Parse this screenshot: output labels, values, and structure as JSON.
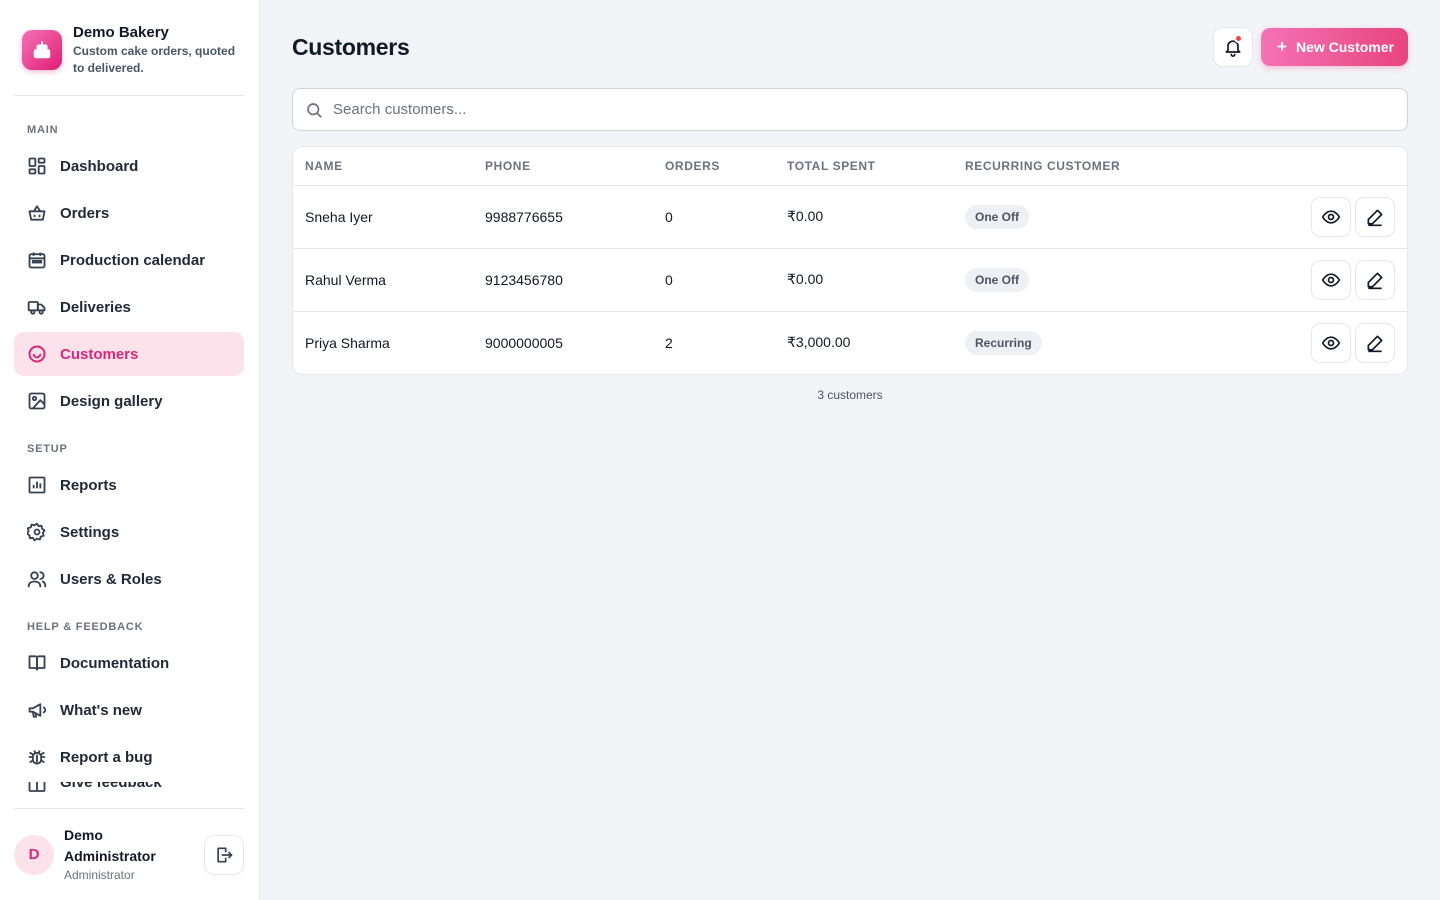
{
  "brand": {
    "name": "Demo Bakery",
    "tagline": "Custom cake orders, quoted to delivered."
  },
  "sidebar": {
    "sections": [
      {
        "label": "MAIN"
      },
      {
        "label": "SETUP"
      },
      {
        "label": "HELP & FEEDBACK"
      }
    ],
    "items": [
      {
        "label": "Dashboard",
        "icon": "dashboard-icon"
      },
      {
        "label": "Orders",
        "icon": "basket-icon"
      },
      {
        "label": "Production calendar",
        "icon": "calendar-icon"
      },
      {
        "label": "Deliveries",
        "icon": "truck-icon"
      },
      {
        "label": "Customers",
        "icon": "smile-icon",
        "active": true
      },
      {
        "label": "Design gallery",
        "icon": "image-icon"
      },
      {
        "label": "Reports",
        "icon": "chart-icon"
      },
      {
        "label": "Settings",
        "icon": "gear-icon"
      },
      {
        "label": "Users & Roles",
        "icon": "users-icon"
      },
      {
        "label": "Documentation",
        "icon": "book-icon"
      },
      {
        "label": "What's new",
        "icon": "megaphone-icon"
      },
      {
        "label": "Report a bug",
        "icon": "bug-icon"
      },
      {
        "label": "Give feedback",
        "icon": "feedback-icon"
      }
    ]
  },
  "user": {
    "initial": "D",
    "name": "Demo Administrator",
    "role": "Administrator"
  },
  "header": {
    "title": "Customers",
    "new_button_label": "New Customer",
    "new_button_icon": "+"
  },
  "search": {
    "placeholder": "Search customers...",
    "value": ""
  },
  "table": {
    "columns": [
      "NAME",
      "PHONE",
      "ORDERS",
      "TOTAL SPENT",
      "RECURRING CUSTOMER"
    ],
    "rows": [
      {
        "name": "Sneha Iyer",
        "phone": "9988776655",
        "orders": "0",
        "total": "₹0.00",
        "recurring": "One Off"
      },
      {
        "name": "Rahul Verma",
        "phone": "9123456780",
        "orders": "0",
        "total": "₹0.00",
        "recurring": "One Off"
      },
      {
        "name": "Priya Sharma",
        "phone": "9000000005",
        "orders": "2",
        "total": "₹3,000.00",
        "recurring": "Recurring"
      }
    ]
  },
  "footer": {
    "count_text": "3 customers"
  },
  "colors": {
    "accent": "#db2777",
    "accent_bg": "#fde2ec",
    "page_bg": "#f3f4f7"
  }
}
